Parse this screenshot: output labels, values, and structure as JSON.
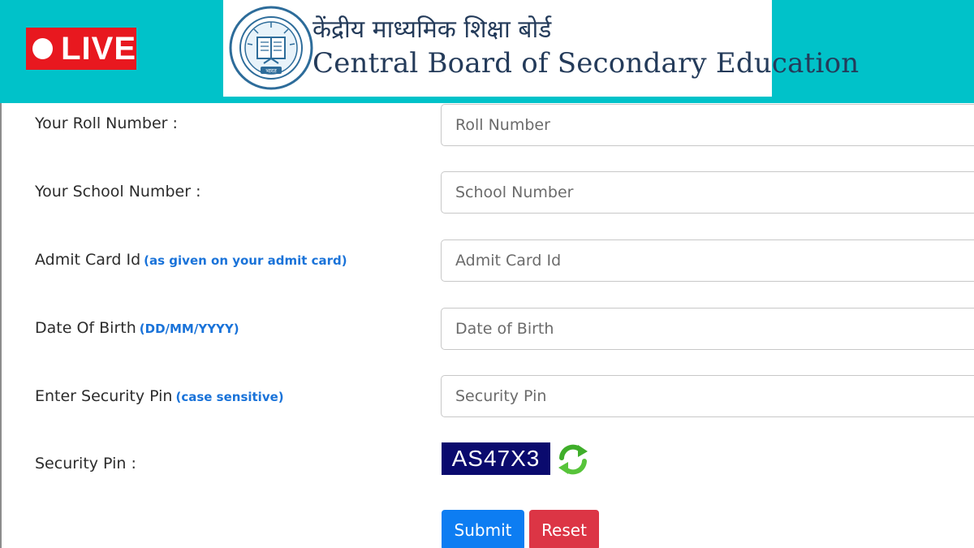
{
  "header": {
    "live_label": "LIVE",
    "board_name_hindi": "केंद्रीय माध्यमिक शिक्षा बोर्ड",
    "board_name_english": "Central Board of Secondary Education",
    "logo_text": "भारत",
    "banner_color": "#00c2c9",
    "live_color": "#e8181f"
  },
  "form": {
    "roll_number": {
      "label": "Your Roll Number :",
      "placeholder": "Roll Number"
    },
    "school_number": {
      "label": "Your School Number :",
      "placeholder": "School Number"
    },
    "admit_card": {
      "label": "Admit Card Id",
      "hint": "(as given on your admit card)",
      "placeholder": "Admit Card Id"
    },
    "dob": {
      "label": "Date Of Birth",
      "hint": "(DD/MM/YYYY)",
      "placeholder": "Date of Birth"
    },
    "security_pin_entry": {
      "label": "Enter Security Pin",
      "hint": "(case sensitive)",
      "placeholder": "Security Pin"
    },
    "security_pin_display": {
      "label": "Security Pin :",
      "captcha_value": "AS47X3"
    },
    "submit_label": "Submit",
    "reset_label": "Reset",
    "hint_color": "#1a73d9",
    "submit_color": "#0d7df2",
    "reset_color": "#dc3545",
    "captcha_bg": "#0a0a6e",
    "refresh_icon": "refresh-arrows-icon"
  }
}
